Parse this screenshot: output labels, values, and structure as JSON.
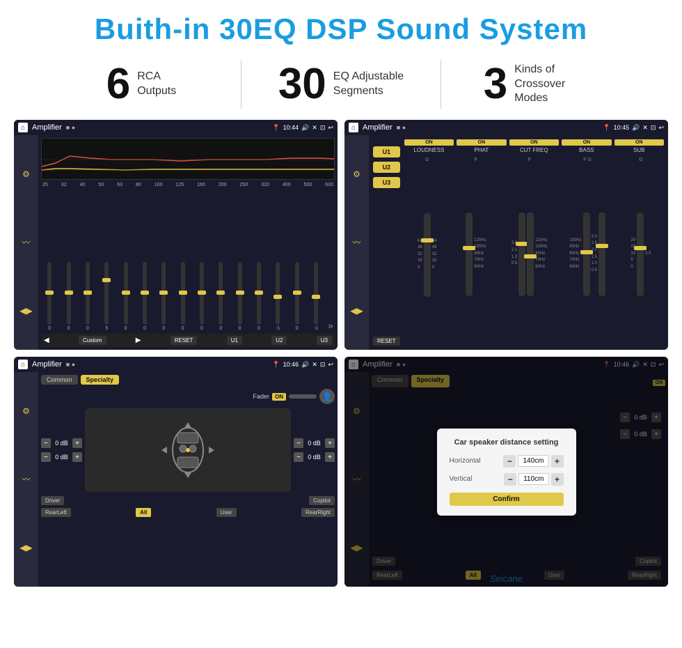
{
  "header": {
    "title": "Buith-in 30EQ DSP Sound System"
  },
  "stats": [
    {
      "number": "6",
      "label": "RCA\nOutputs"
    },
    {
      "number": "30",
      "label": "EQ Adjustable\nSegments"
    },
    {
      "number": "3",
      "label": "Kinds of\nCrossover Modes"
    }
  ],
  "screens": {
    "eq": {
      "title": "Amplifier",
      "time": "10:44",
      "freqs": [
        "25",
        "32",
        "40",
        "50",
        "63",
        "80",
        "100",
        "125",
        "160",
        "200",
        "250",
        "320",
        "400",
        "500",
        "630"
      ],
      "values": [
        "0",
        "0",
        "0",
        "5",
        "0",
        "0",
        "0",
        "0",
        "0",
        "0",
        "0",
        "0",
        "-1",
        "0",
        "-1"
      ],
      "buttons": [
        "Custom",
        "RESET",
        "U1",
        "U2",
        "U3"
      ]
    },
    "crossover": {
      "title": "Amplifier",
      "time": "10:45",
      "presets": [
        "U1",
        "U2",
        "U3"
      ],
      "controls": [
        {
          "label": "LOUDNESS",
          "on": true
        },
        {
          "label": "PHAT",
          "on": true
        },
        {
          "label": "CUT FREQ",
          "on": true
        },
        {
          "label": "BASS",
          "on": true
        },
        {
          "label": "SUB",
          "on": true
        }
      ],
      "reset_label": "RESET"
    },
    "speaker1": {
      "title": "Amplifier",
      "time": "10:46",
      "tabs": [
        "Common",
        "Specialty"
      ],
      "active_tab": "Specialty",
      "fader_label": "Fader",
      "fader_on": "ON",
      "positions": [
        "Driver",
        "RearLeft",
        "All",
        "User",
        "RearRight",
        "Copilot"
      ],
      "db_values": [
        "0 dB",
        "0 dB",
        "0 dB",
        "0 dB"
      ]
    },
    "speaker2": {
      "title": "Amplifier",
      "time": "10:46",
      "tabs": [
        "Common",
        "Specialty"
      ],
      "active_tab": "Specialty",
      "dialog": {
        "title": "Car speaker distance setting",
        "horizontal_label": "Horizontal",
        "horizontal_value": "140cm",
        "vertical_label": "Vertical",
        "vertical_value": "110cm",
        "confirm_label": "Confirm",
        "db_right": "0 dB",
        "db_right2": "0 dB"
      },
      "positions": [
        "Driver",
        "RearLeft",
        "All",
        "User",
        "RearRight",
        "Copilot"
      ]
    }
  },
  "watermark": "Seicane"
}
